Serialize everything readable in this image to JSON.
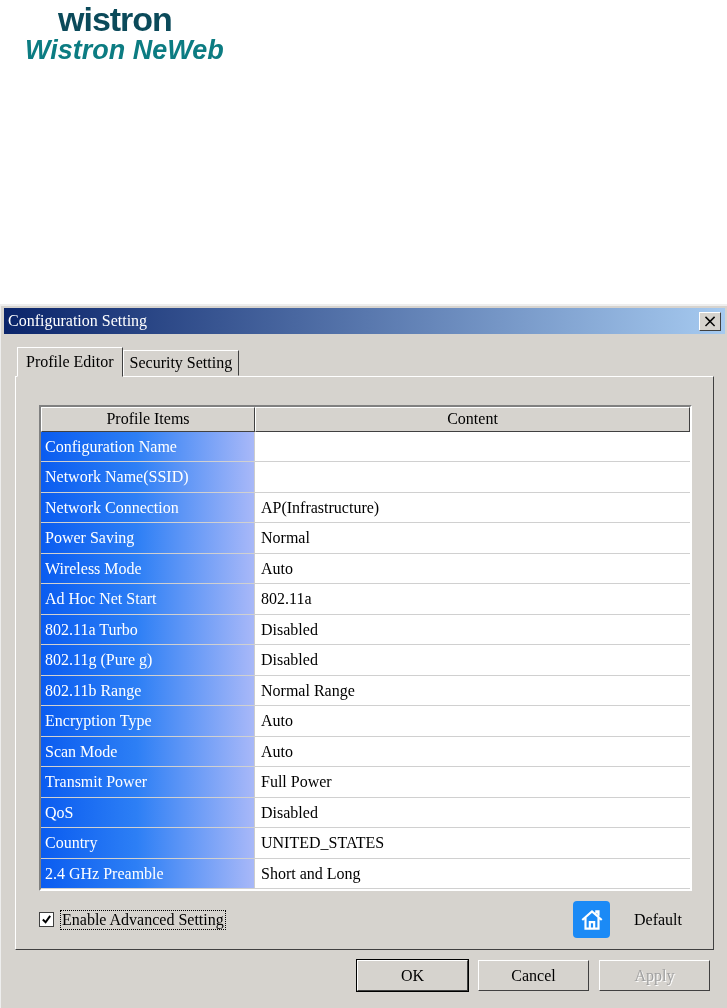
{
  "logo": {
    "brand": "wistron",
    "subtitle": "Wistron NeWeb"
  },
  "window": {
    "title": "Configuration Setting",
    "close": "×"
  },
  "tabs": [
    {
      "label": "Profile Editor",
      "selected": true
    },
    {
      "label": "Security Setting",
      "selected": false
    }
  ],
  "table": {
    "columns": [
      "Profile Items",
      "Content"
    ],
    "rows": [
      {
        "item": "Configuration Name"
      },
      {
        "item": "Network Name(SSID)"
      },
      {
        "item": "Network Connection",
        "content": "AP(Infrastructure)"
      },
      {
        "item": "Power Saving",
        "content": "Normal"
      },
      {
        "item": "Wireless Mode",
        "content": "Auto"
      },
      {
        "item": "Ad Hoc Net Start",
        "content": "802.11a"
      },
      {
        "item": "802.11a Turbo",
        "content": "Disabled"
      },
      {
        "item": "802.11g (Pure g)",
        "content": "Disabled"
      },
      {
        "item": "802.11b Range",
        "content": "Normal Range"
      },
      {
        "item": "Encryption Type",
        "content": "Auto"
      },
      {
        "item": "Scan Mode",
        "content": "Auto"
      },
      {
        "item": "Transmit Power",
        "content": "Full Power"
      },
      {
        "item": "QoS",
        "content": "Disabled"
      },
      {
        "item": "Country",
        "content": "UNITED_STATES"
      },
      {
        "item": "2.4 GHz Preamble",
        "content": "Short and Long"
      }
    ]
  },
  "advanced": {
    "label": "Enable Advanced Setting",
    "checked": true
  },
  "default_label": "Default",
  "buttons": [
    {
      "label": "OK",
      "disabled": false,
      "default": true
    },
    {
      "label": "Cancel",
      "disabled": false,
      "default": false
    },
    {
      "label": "Apply",
      "disabled": true,
      "default": false
    }
  ]
}
